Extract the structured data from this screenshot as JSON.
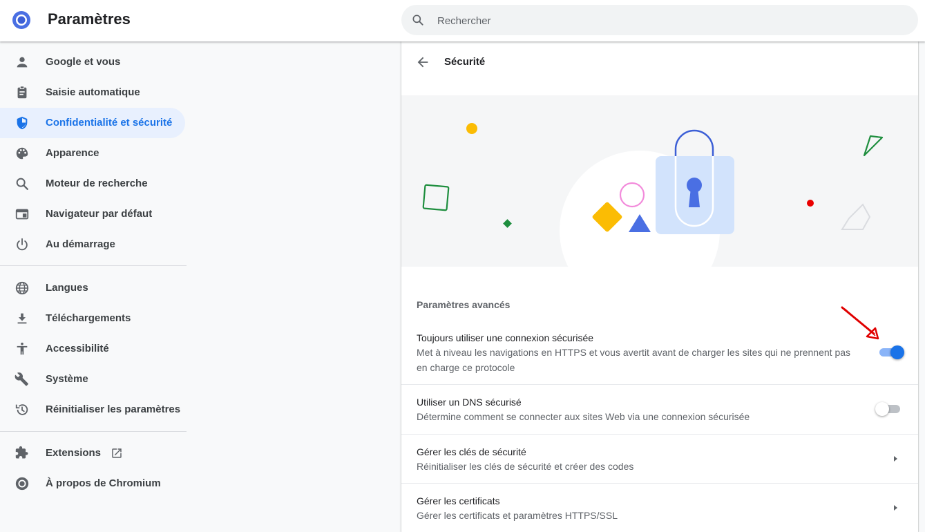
{
  "header": {
    "app_title": "Paramètres",
    "search_placeholder": "Rechercher"
  },
  "sidebar": {
    "items": [
      {
        "label": "Google et vous",
        "icon": "person-icon"
      },
      {
        "label": "Saisie automatique",
        "icon": "clipboard-icon"
      },
      {
        "label": "Confidentialité et sécurité",
        "icon": "shield-icon",
        "active": true
      },
      {
        "label": "Apparence",
        "icon": "palette-icon"
      },
      {
        "label": "Moteur de recherche",
        "icon": "search-icon"
      },
      {
        "label": "Navigateur par défaut",
        "icon": "browser-window-icon"
      },
      {
        "label": "Au démarrage",
        "icon": "power-icon"
      },
      {
        "label": "Langues",
        "icon": "globe-icon"
      },
      {
        "label": "Téléchargements",
        "icon": "download-icon"
      },
      {
        "label": "Accessibilité",
        "icon": "accessibility-icon"
      },
      {
        "label": "Système",
        "icon": "wrench-icon"
      },
      {
        "label": "Réinitialiser les paramètres",
        "icon": "restore-icon"
      },
      {
        "label": "Extensions",
        "icon": "puzzle-icon"
      },
      {
        "label": "À propos de Chromium",
        "icon": "chromium-icon"
      }
    ]
  },
  "main": {
    "page_title": "Sécurité",
    "section_title": "Paramètres avancés",
    "rows": [
      {
        "title": "Toujours utiliser une connexion sécurisée",
        "description": "Met à niveau les navigations en HTTPS et vous avertit avant de charger les sites qui ne prennent pas en charge ce protocole",
        "control": "toggle",
        "enabled": true
      },
      {
        "title": "Utiliser un DNS sécurisé",
        "description": "Détermine comment se connecter aux sites Web via une connexion sécurisée",
        "control": "toggle",
        "enabled": false
      },
      {
        "title": "Gérer les clés de sécurité",
        "description": "Réinitialiser les clés de sécurité et créer des codes",
        "control": "chevron"
      },
      {
        "title": "Gérer les certificats",
        "description": "Gérer les certificats et paramètres HTTPS/SSL",
        "control": "chevron"
      }
    ]
  },
  "colors": {
    "accent": "#1a73e8",
    "active_nav_bg": "#e8f0fe",
    "annotation_arrow": "#e00000"
  }
}
